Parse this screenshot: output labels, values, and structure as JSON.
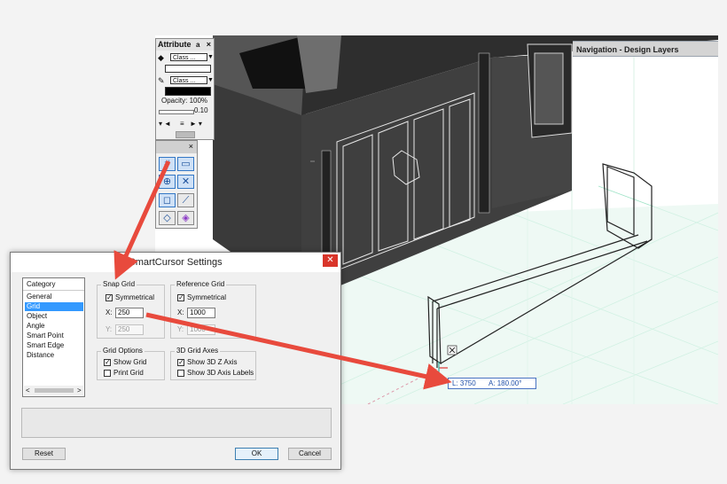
{
  "navigation": {
    "title": "Navigation - Design Layers"
  },
  "attribute_palette": {
    "title": "Attribute",
    "pin_glyph": "a",
    "close_glyph": "×",
    "fill_class_label": "Class ...",
    "pen_class_label": "Class ...",
    "opacity_label": "Opacity: 100%",
    "thickness_value": "0.10",
    "icons": [
      "paint-bucket-icon",
      "pencil-icon",
      "arrow-left-icon",
      "arrow-right-icon",
      "collapse-icon"
    ]
  },
  "snap_palette": {
    "close_glyph": "×",
    "buttons": [
      "snap-grid",
      "snap-object",
      "snap-angle",
      "smart-edge",
      "snap-distance",
      "snap-tangent",
      "snap-intersection",
      "snap-surface"
    ]
  },
  "dialog": {
    "title": "SmartCursor Settings",
    "close_glyph": "✕",
    "category_header": "Category",
    "categories": [
      "General",
      "Grid",
      "Object",
      "Angle",
      "Smart Point",
      "Smart Edge",
      "Distance"
    ],
    "selected_category": "Grid",
    "snap_grid": {
      "label": "Snap Grid",
      "symmetrical_label": "Symmetrical",
      "x_label": "X:",
      "x_value": "250",
      "y_label": "Y:",
      "y_value": "250"
    },
    "reference_grid": {
      "label": "Reference Grid",
      "symmetrical_label": "Symmetrical",
      "x_label": "X:",
      "x_value": "1000",
      "y_label": "Y:",
      "y_value": "1000"
    },
    "grid_options": {
      "label": "Grid Options",
      "show_grid_label": "Show Grid",
      "print_grid_label": "Print Grid"
    },
    "grid_axes_3d": {
      "label": "3D Grid Axes",
      "show_z_label": "Show 3D Z Axis",
      "show_labels_label": "Show 3D Axis Labels"
    },
    "reset_label": "Reset",
    "ok_label": "OK",
    "cancel_label": "Cancel",
    "scroll_left": "<",
    "scroll_right": ">"
  },
  "readout": {
    "length": "L: 3750",
    "angle": "A: 180.00°"
  },
  "colors": {
    "arrow": "#e84a3d",
    "selection": "#3399ff",
    "grid": "#7fd6b4",
    "building": "#3a3a3a"
  }
}
